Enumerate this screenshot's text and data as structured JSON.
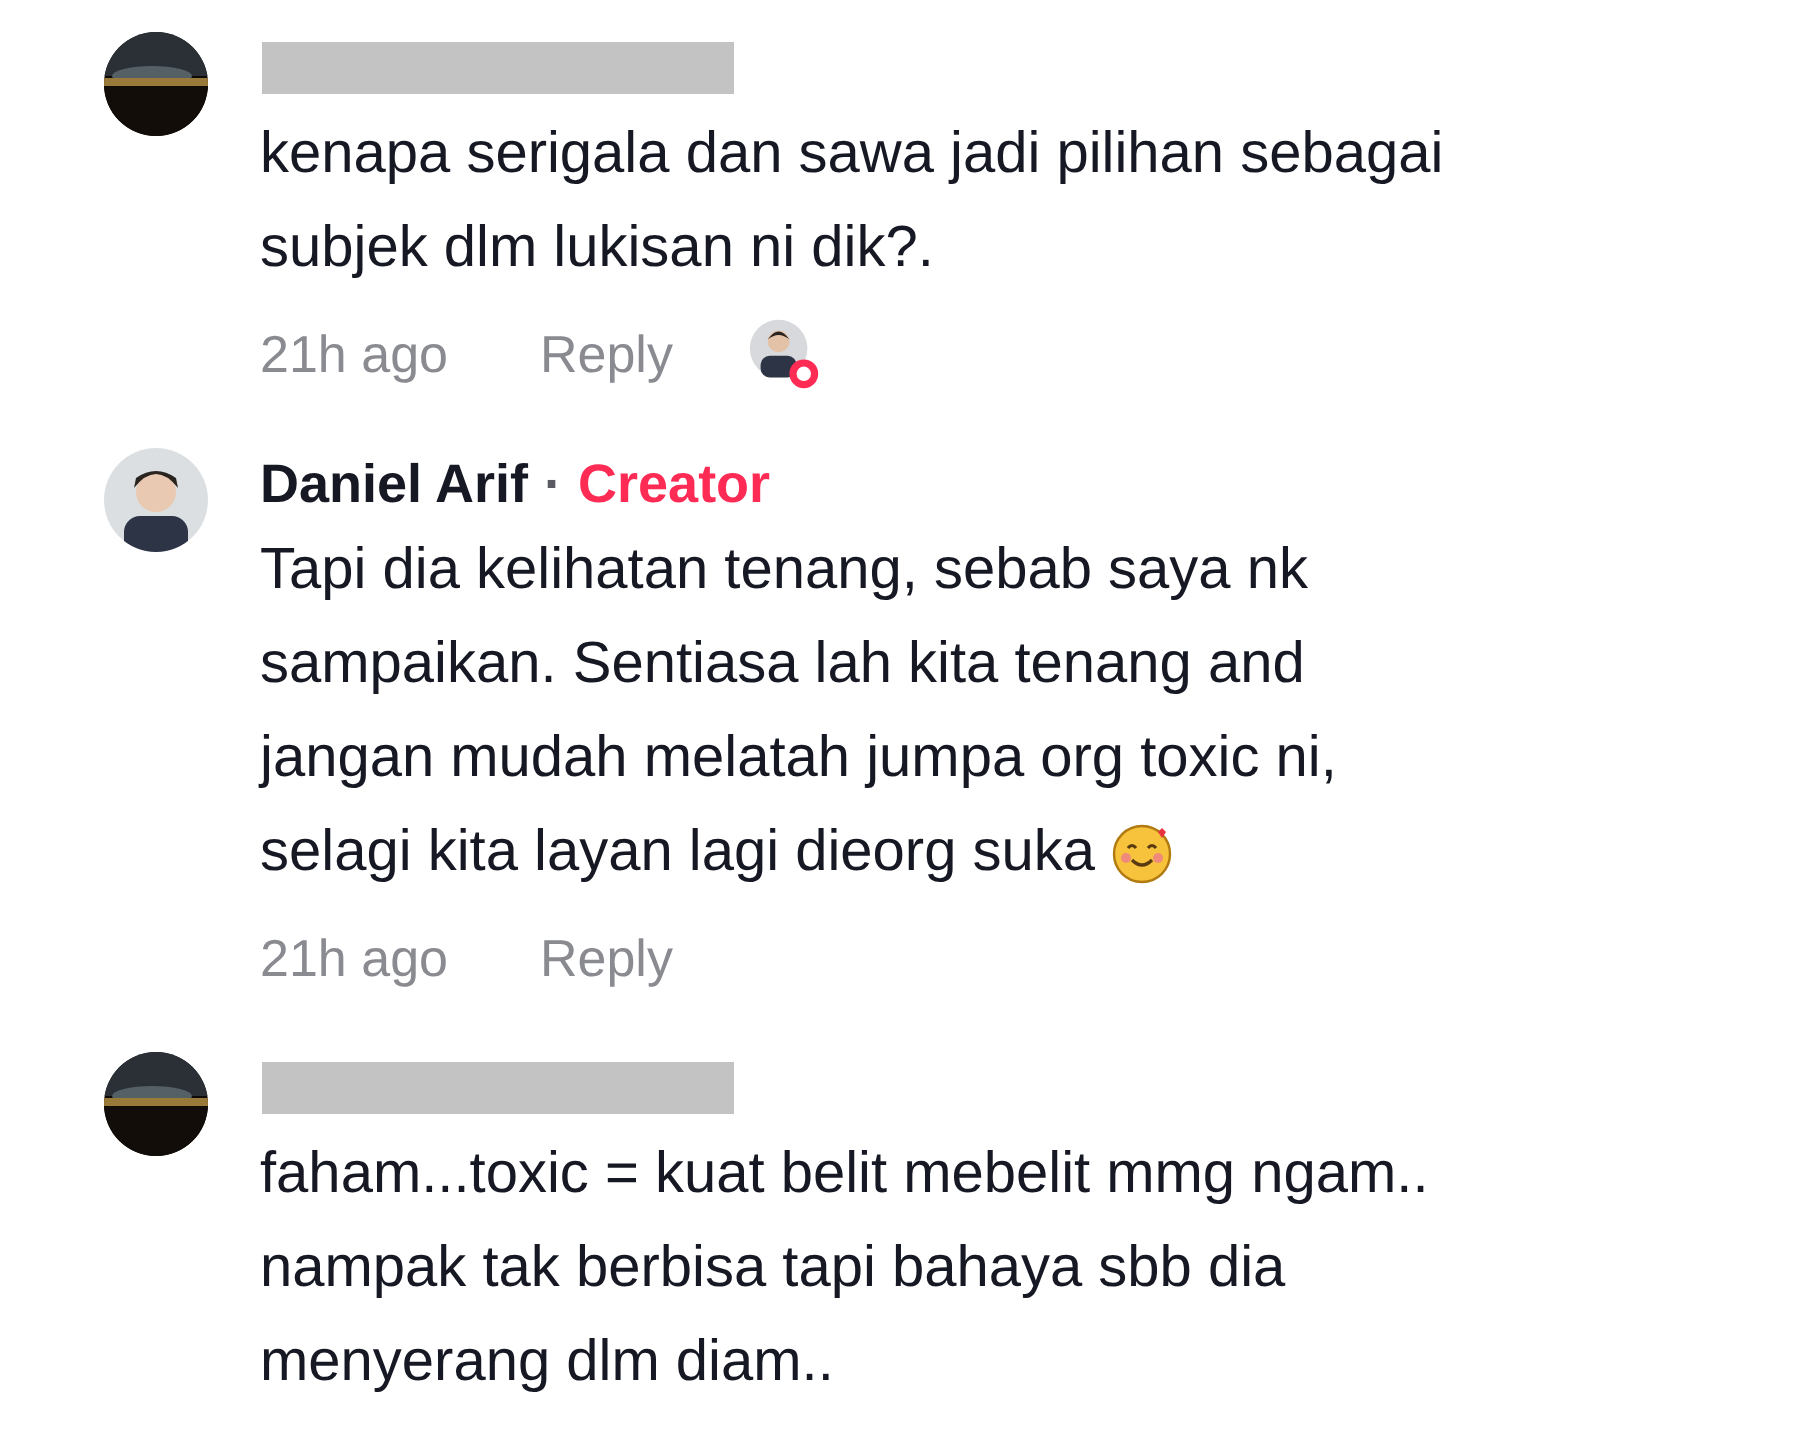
{
  "comments": [
    {
      "author_redacted": true,
      "lines": [
        "kenapa serigala dan sawa jadi pilihan sebagai",
        "subjek dlm lukisan ni dik?."
      ],
      "time": "21h ago",
      "reply": "Reply",
      "liked_by_creator": true
    },
    {
      "author": "Daniel Arif",
      "separator": "·",
      "badge": "Creator",
      "lines": [
        "Tapi dia kelihatan tenang, sebab saya nk",
        "sampaikan. Sentiasa lah kita tenang and",
        "jangan mudah melatah jumpa org toxic ni,",
        "selagi kita layan lagi dieorg suka"
      ],
      "time": "21h ago",
      "reply": "Reply",
      "trailing_emoji": true
    },
    {
      "author_redacted": true,
      "lines": [
        "faham...toxic = kuat belit mebelit mmg ngam..",
        "nampak tak berbisa tapi bahaya sbb dia",
        "menyerang dlm diam.."
      ]
    }
  ]
}
